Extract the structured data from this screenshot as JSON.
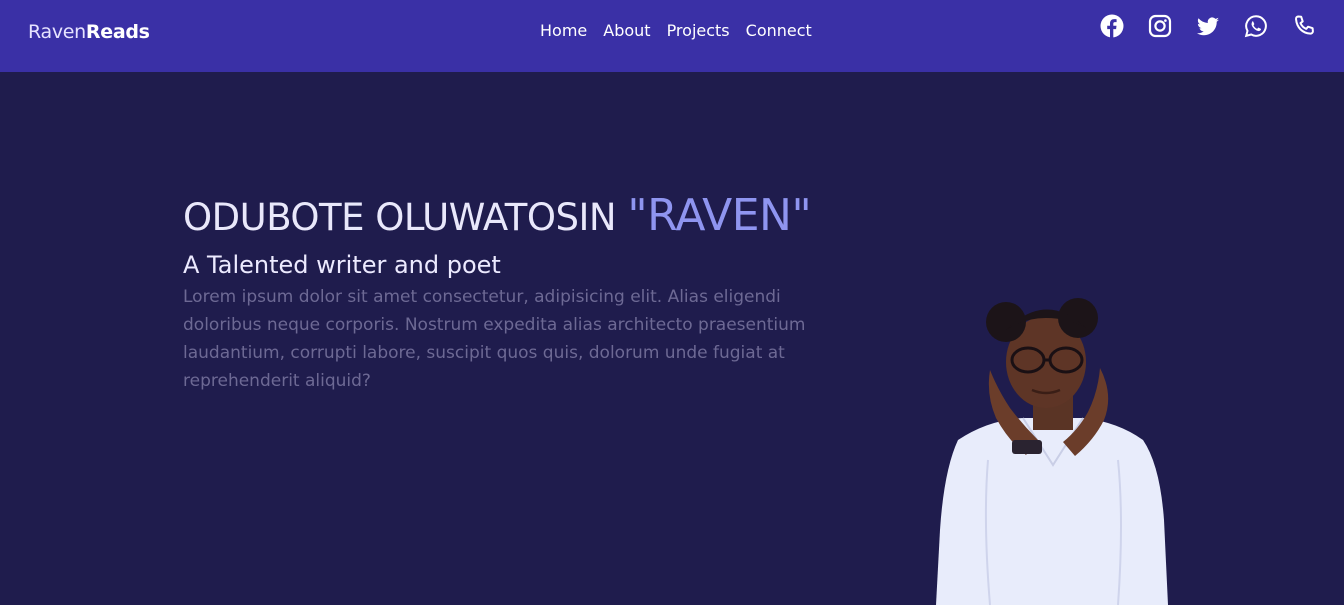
{
  "brand": {
    "part1": "Raven",
    "part2": "Reads"
  },
  "nav": {
    "items": [
      "Home",
      "About",
      "Projects",
      "Connect"
    ]
  },
  "social": [
    {
      "icon": "facebook-icon"
    },
    {
      "icon": "instagram-icon"
    },
    {
      "icon": "twitter-icon"
    },
    {
      "icon": "whatsapp-icon"
    },
    {
      "icon": "phone-icon"
    }
  ],
  "hero": {
    "name": "ODUBOTE OLUWATOSIN",
    "nickname": "\"RAVEN\"",
    "subtitle": "A Talented writer and poet",
    "bio": "Lorem ipsum dolor sit amet consectetur, adipisicing elit. Alias eligendi doloribus neque corporis. Nostrum expedita alias architecto praesentium laudantium, corrupti labore, suscipit quos quis, dolorum unde fugiat at reprehenderit aliquid?"
  },
  "colors": {
    "navbar": "#3a30a6",
    "background": "#1f1c4d",
    "accent": "#8f95f0",
    "muted_text": "#6d6994"
  }
}
